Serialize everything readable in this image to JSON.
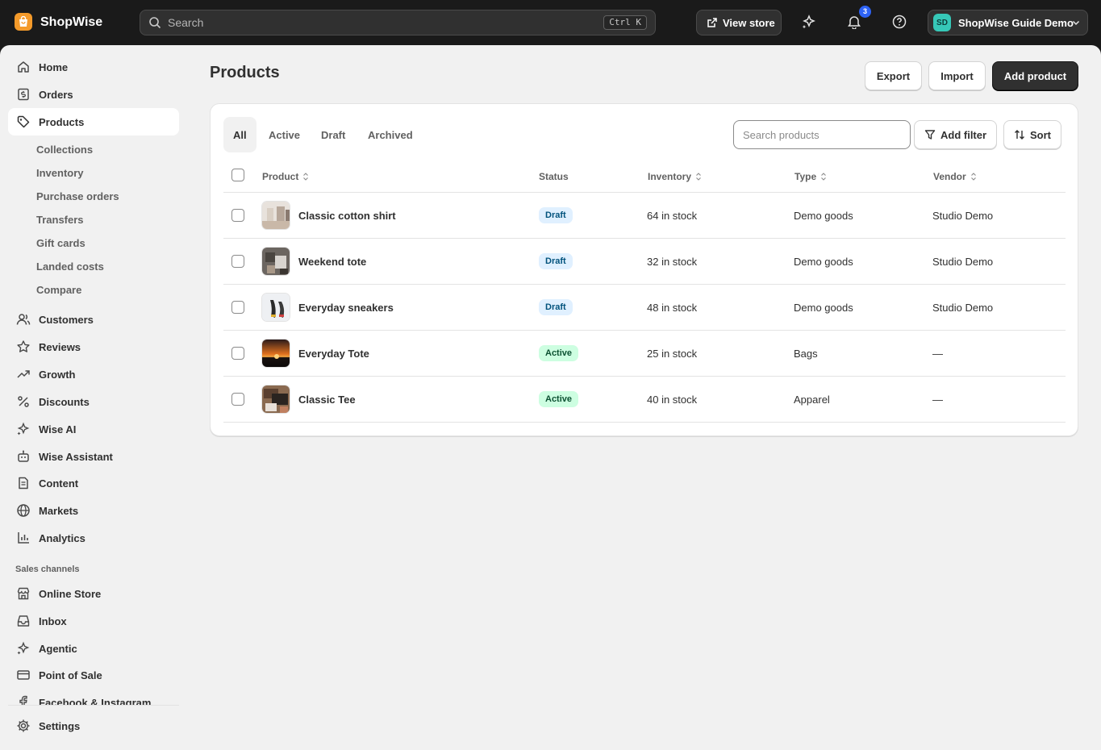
{
  "topbar": {
    "brand": "ShopWise",
    "search_placeholder": "Search",
    "search_shortcut": "Ctrl K",
    "view_store": "View store",
    "notification_count": "3",
    "account_initials": "SD",
    "account_name": "ShopWise Guide Demo"
  },
  "sidebar": {
    "items": [
      {
        "label": "Home",
        "icon": "home-icon"
      },
      {
        "label": "Orders",
        "icon": "orders-icon"
      },
      {
        "label": "Products",
        "icon": "tag-icon"
      },
      {
        "label": "Customers",
        "icon": "person-icon"
      },
      {
        "label": "Reviews",
        "icon": "star-icon"
      },
      {
        "label": "Growth",
        "icon": "trend-icon"
      },
      {
        "label": "Discounts",
        "icon": "percent-icon"
      },
      {
        "label": "Wise AI",
        "icon": "sparkle-icon"
      },
      {
        "label": "Wise Assistant",
        "icon": "robot-icon"
      },
      {
        "label": "Content",
        "icon": "document-icon"
      },
      {
        "label": "Markets",
        "icon": "globe-icon"
      },
      {
        "label": "Analytics",
        "icon": "bar-chart-icon"
      }
    ],
    "sub_items": [
      "Collections",
      "Inventory",
      "Purchase orders",
      "Transfers",
      "Gift cards",
      "Landed costs",
      "Compare"
    ],
    "sales_channels_label": "Sales channels",
    "channels": [
      {
        "label": "Online Store",
        "icon": "store-icon"
      },
      {
        "label": "Inbox",
        "icon": "inbox-icon"
      },
      {
        "label": "Agentic",
        "icon": "sparkle-icon"
      },
      {
        "label": "Point of Sale",
        "icon": "pos-icon"
      },
      {
        "label": "Facebook & Instagram",
        "icon": "social-icon"
      }
    ],
    "settings": "Settings"
  },
  "page": {
    "title": "Products",
    "export": "Export",
    "import": "Import",
    "add_product": "Add product"
  },
  "tabs": [
    "All",
    "Active",
    "Draft",
    "Archived"
  ],
  "toolbar": {
    "search_placeholder": "Search products",
    "add_filter": "Add filter",
    "sort": "Sort"
  },
  "table": {
    "headers": [
      "Product",
      "Status",
      "Inventory",
      "Type",
      "Vendor"
    ],
    "rows": [
      {
        "name": "Classic cotton shirt",
        "status": "Draft",
        "inventory": "64 in stock",
        "type": "Demo goods",
        "vendor": "Studio Demo"
      },
      {
        "name": "Weekend tote",
        "status": "Draft",
        "inventory": "32 in stock",
        "type": "Demo goods",
        "vendor": "Studio Demo"
      },
      {
        "name": "Everyday sneakers",
        "status": "Draft",
        "inventory": "48 in stock",
        "type": "Demo goods",
        "vendor": "Studio Demo"
      },
      {
        "name": "Everyday Tote",
        "status": "Active",
        "inventory": "25 in stock",
        "type": "Bags",
        "vendor": "—"
      },
      {
        "name": "Classic Tee",
        "status": "Active",
        "inventory": "40 in stock",
        "type": "Apparel",
        "vendor": "—"
      }
    ]
  }
}
